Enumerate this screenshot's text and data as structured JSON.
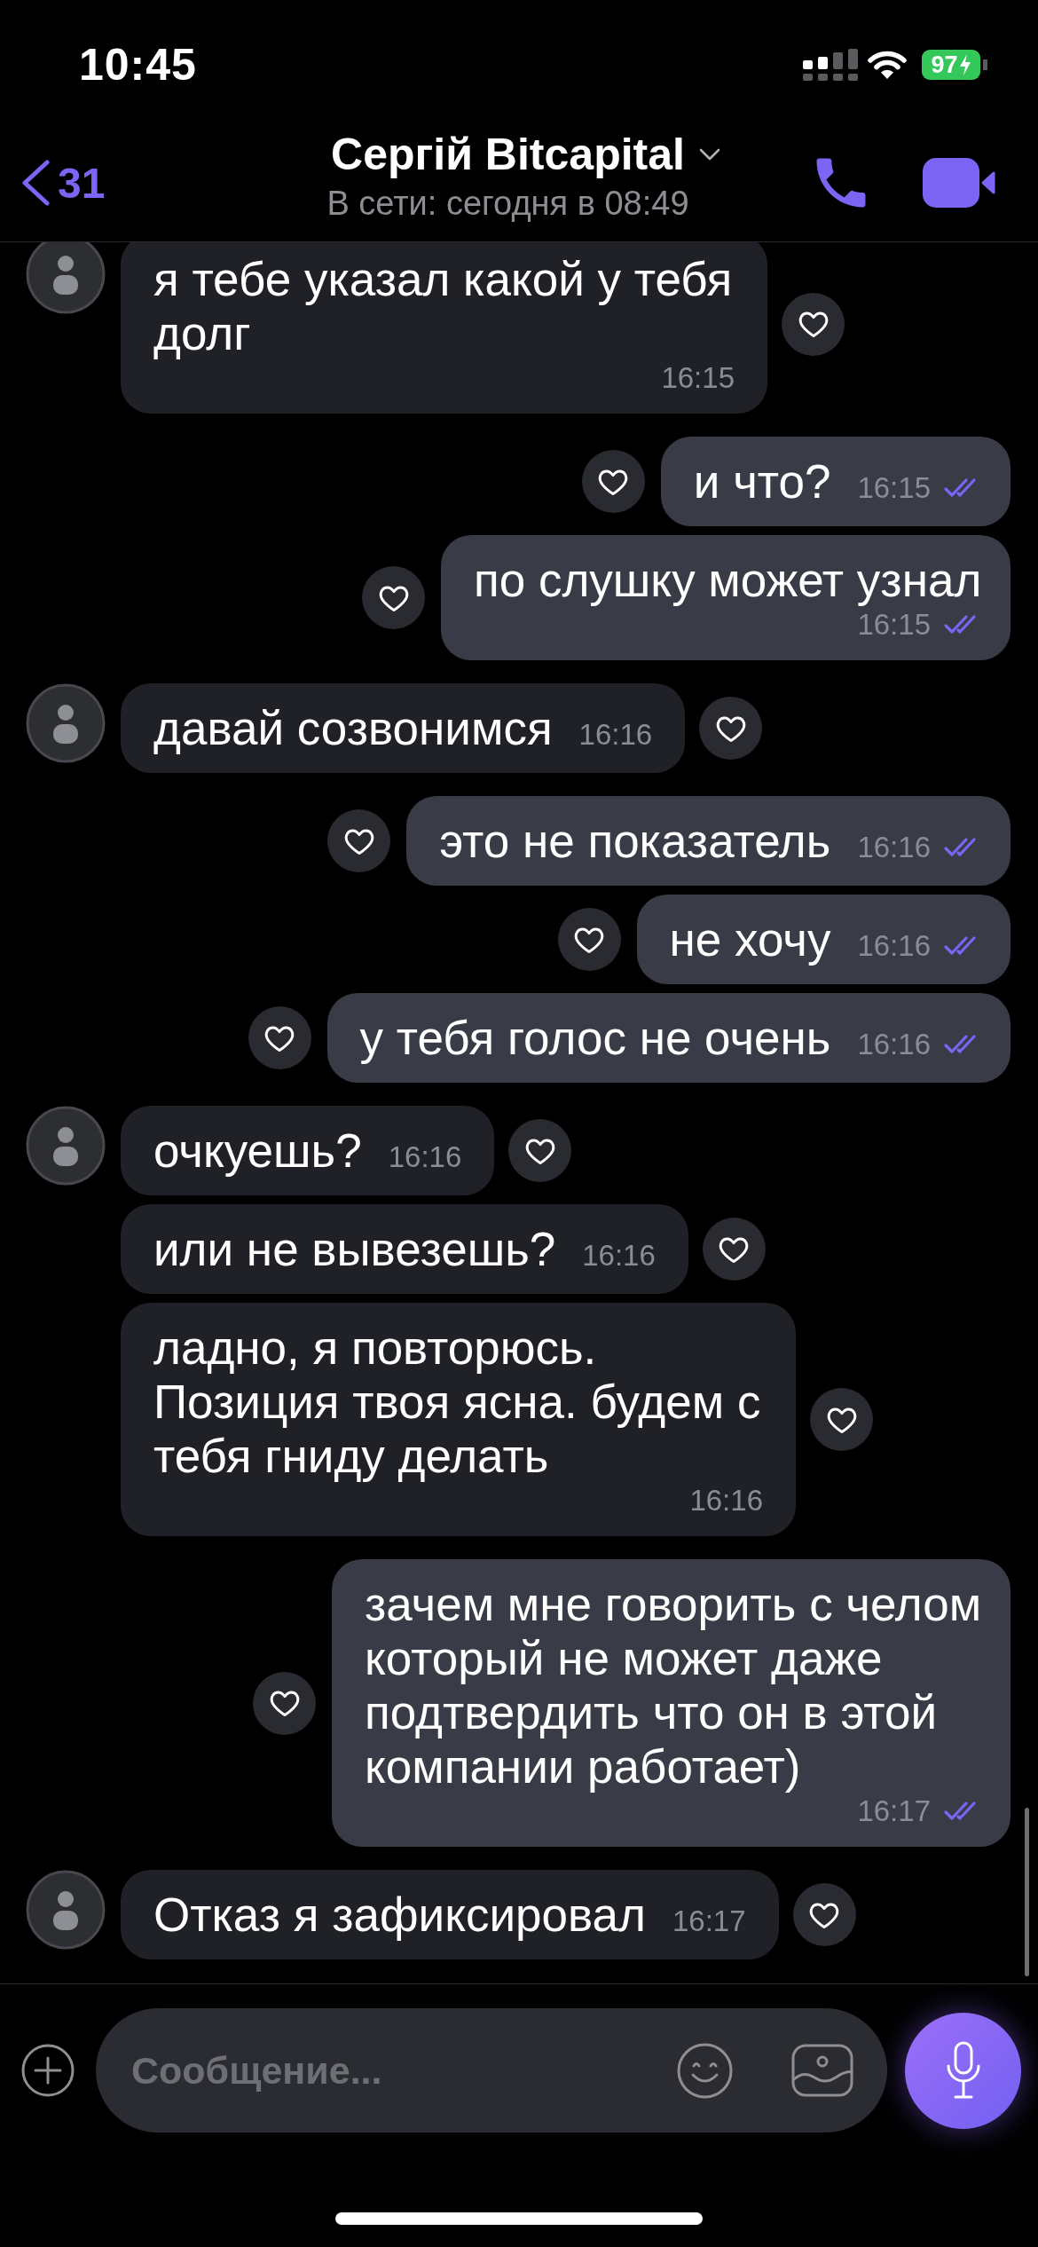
{
  "status_bar": {
    "time": "10:45",
    "battery": "97"
  },
  "header": {
    "back_count": "31",
    "title": "Сергій Bitcapital",
    "subtitle": "В сети: сегодня в 08:49"
  },
  "groups": [
    {
      "kind": "incoming",
      "messages": [
        {
          "text": "я тебе указал какой у тебя долг",
          "time": "16:15"
        }
      ]
    },
    {
      "kind": "outgoing",
      "messages": [
        {
          "text": "и что?",
          "time": "16:15",
          "read": true
        },
        {
          "text": "по слушку может узнал",
          "time": "16:15",
          "read": true
        }
      ]
    },
    {
      "kind": "incoming",
      "messages": [
        {
          "text": "давай созвонимся",
          "time": "16:16"
        }
      ]
    },
    {
      "kind": "outgoing",
      "messages": [
        {
          "text": "это не показатель",
          "time": "16:16",
          "read": true
        },
        {
          "text": "не хочу",
          "time": "16:16",
          "read": true
        },
        {
          "text": "у тебя голос не очень",
          "time": "16:16",
          "read": true
        }
      ]
    },
    {
      "kind": "incoming",
      "messages": [
        {
          "text": "очкуешь?",
          "time": "16:16"
        },
        {
          "text": "или не вывезешь?",
          "time": "16:16"
        },
        {
          "text": "ладно, я повторюсь. Позиция твоя ясна. будем с тебя гниду делать",
          "time": "16:16"
        }
      ]
    },
    {
      "kind": "outgoing",
      "messages": [
        {
          "text": "зачем мне говорить с челом который не может даже подтвердить что он в этой компании работает)",
          "time": "16:17",
          "read": true
        }
      ]
    },
    {
      "kind": "incoming",
      "messages": [
        {
          "text": "Отказ я зафиксировал",
          "time": "16:17"
        }
      ]
    }
  ],
  "composer": {
    "placeholder": "Сообщение..."
  }
}
